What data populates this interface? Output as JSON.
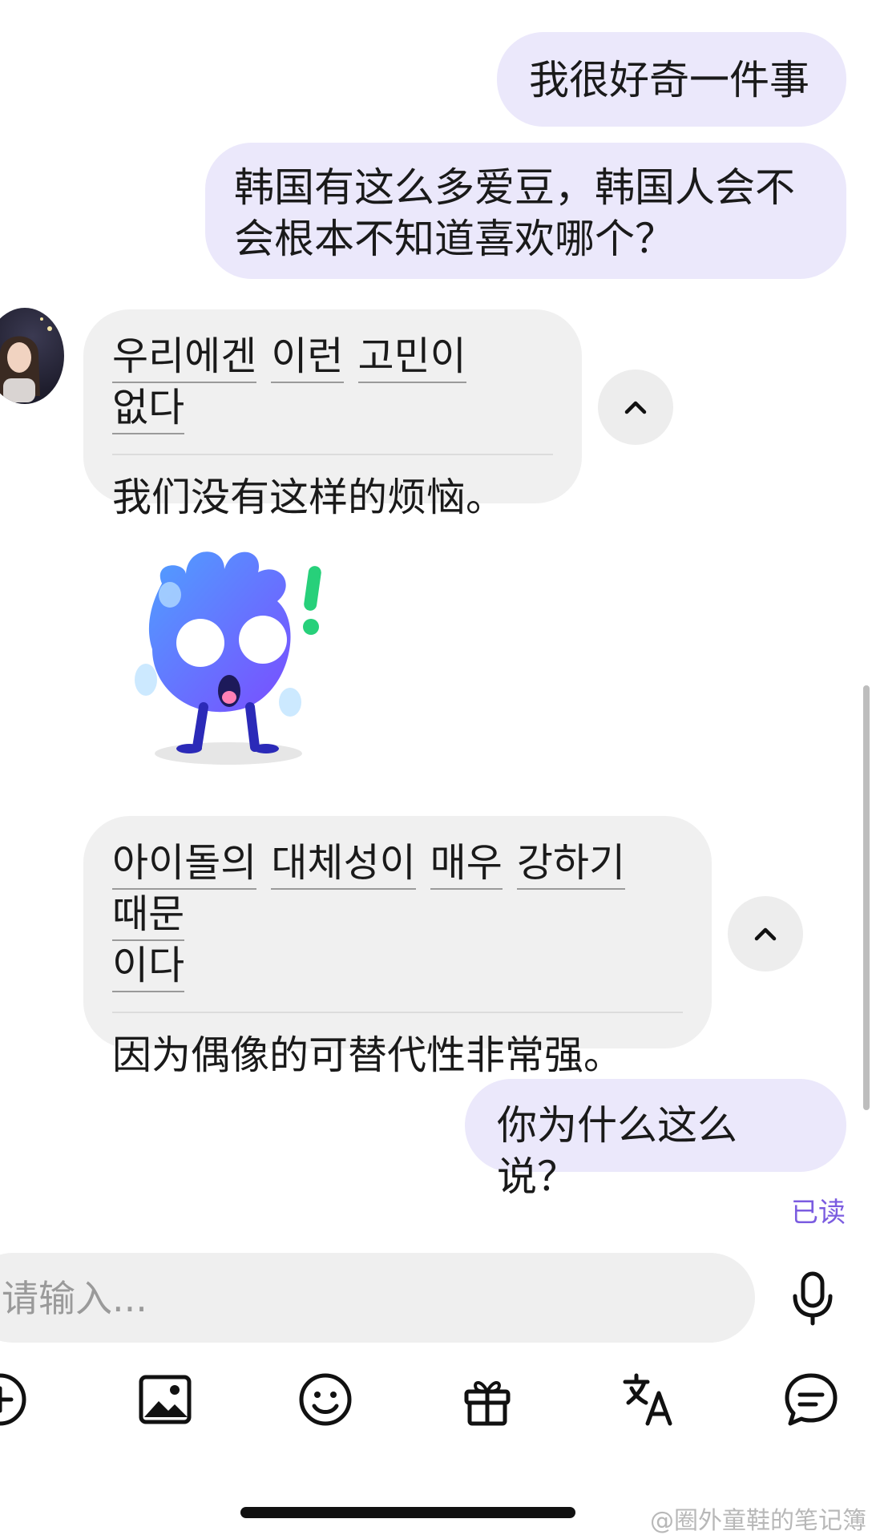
{
  "messages": {
    "user_1": "我很好奇一件事",
    "user_2_line1": "韩国有这么多爱豆，韩国人会不",
    "user_2_line2": "会根本不知道喜欢哪个？",
    "bot_1_korean_words": [
      "우리에겐",
      "이런",
      "고민이",
      "없다"
    ],
    "bot_1_translation": "我们没有这样的烦恼。",
    "bot_2_korean_words_line1": [
      "아이돌의",
      "대체성이",
      "매우",
      "강하기",
      "때문"
    ],
    "bot_2_korean_words_line2": [
      "이다"
    ],
    "bot_2_translation": "因为偶像的可替代性非常强。",
    "user_3": "你为什么这么说？",
    "read_status": "已读"
  },
  "input": {
    "placeholder": "请输入..."
  },
  "icons": {
    "collapse": "chevron-up-icon",
    "mic": "microphone-icon",
    "toolbar": [
      "add-icon",
      "image-icon",
      "emoji-icon",
      "gift-icon",
      "translate-icon",
      "chat-bubble-icon"
    ]
  },
  "watermark": "@圈外童鞋的笔记簿",
  "colors": {
    "user_bubble": "#ebe8fb",
    "bot_bubble": "#f0f0f0",
    "read_accent": "#7b5ce0",
    "sticker_blue": "#4f7dff",
    "sticker_green": "#27d07a"
  }
}
